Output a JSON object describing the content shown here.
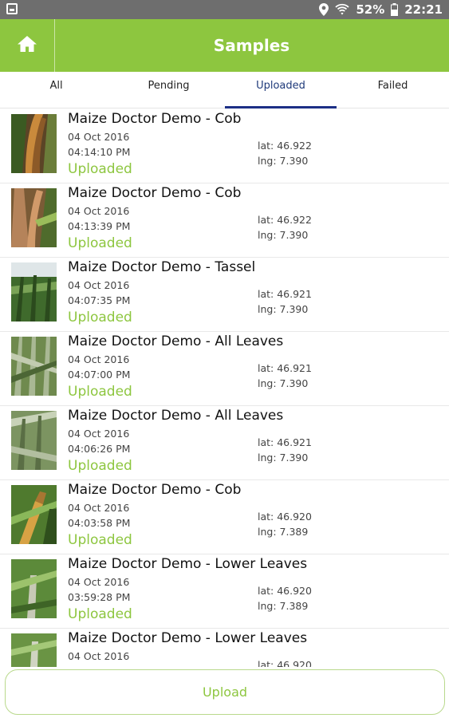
{
  "status_bar": {
    "battery": "52%",
    "time": "22:21",
    "icons": [
      "screenshot-icon",
      "location-icon",
      "wifi-icon",
      "battery-icon"
    ]
  },
  "app_bar": {
    "title": "Samples",
    "home_icon": "home-icon",
    "color": "#8dc63f"
  },
  "tabs": [
    {
      "label": "All",
      "active": false
    },
    {
      "label": "Pending",
      "active": false
    },
    {
      "label": "Uploaded",
      "active": true
    },
    {
      "label": "Failed",
      "active": false
    }
  ],
  "samples": [
    {
      "title": "Maize Doctor Demo - Cob",
      "date": "04 Oct 2016",
      "time": "04:14:10 PM",
      "status": "Uploaded",
      "lat": "lat: 46.922",
      "lng": "lng: 7.390"
    },
    {
      "title": "Maize Doctor Demo - Cob",
      "date": "04 Oct 2016",
      "time": "04:13:39 PM",
      "status": "Uploaded",
      "lat": "lat: 46.922",
      "lng": "lng: 7.390"
    },
    {
      "title": "Maize Doctor Demo - Tassel",
      "date": "04 Oct 2016",
      "time": "04:07:35 PM",
      "status": "Uploaded",
      "lat": "lat: 46.921",
      "lng": "lng: 7.390"
    },
    {
      "title": "Maize Doctor Demo - All Leaves",
      "date": "04 Oct 2016",
      "time": "04:07:00 PM",
      "status": "Uploaded",
      "lat": "lat: 46.921",
      "lng": "lng: 7.390"
    },
    {
      "title": "Maize Doctor Demo - All Leaves",
      "date": "04 Oct 2016",
      "time": "04:06:26 PM",
      "status": "Uploaded",
      "lat": "lat: 46.921",
      "lng": "lng: 7.390"
    },
    {
      "title": "Maize Doctor Demo - Cob",
      "date": "04 Oct 2016",
      "time": "04:03:58 PM",
      "status": "Uploaded",
      "lat": "lat: 46.920",
      "lng": "lng: 7.389"
    },
    {
      "title": "Maize Doctor Demo - Lower Leaves",
      "date": "04 Oct 2016",
      "time": "03:59:28 PM",
      "status": "Uploaded",
      "lat": "lat: 46.920",
      "lng": "lng: 7.389"
    },
    {
      "title": "Maize Doctor Demo - Lower Leaves",
      "date": "04 Oct 2016",
      "time": "",
      "status": "",
      "lat": "lat: 46.920",
      "lng": ""
    }
  ],
  "upload_button": {
    "label": "Upload"
  },
  "colors": {
    "accent": "#8dc63f",
    "tab_indicator": "#1c2f86",
    "status_bar": "#6e6e6e"
  }
}
